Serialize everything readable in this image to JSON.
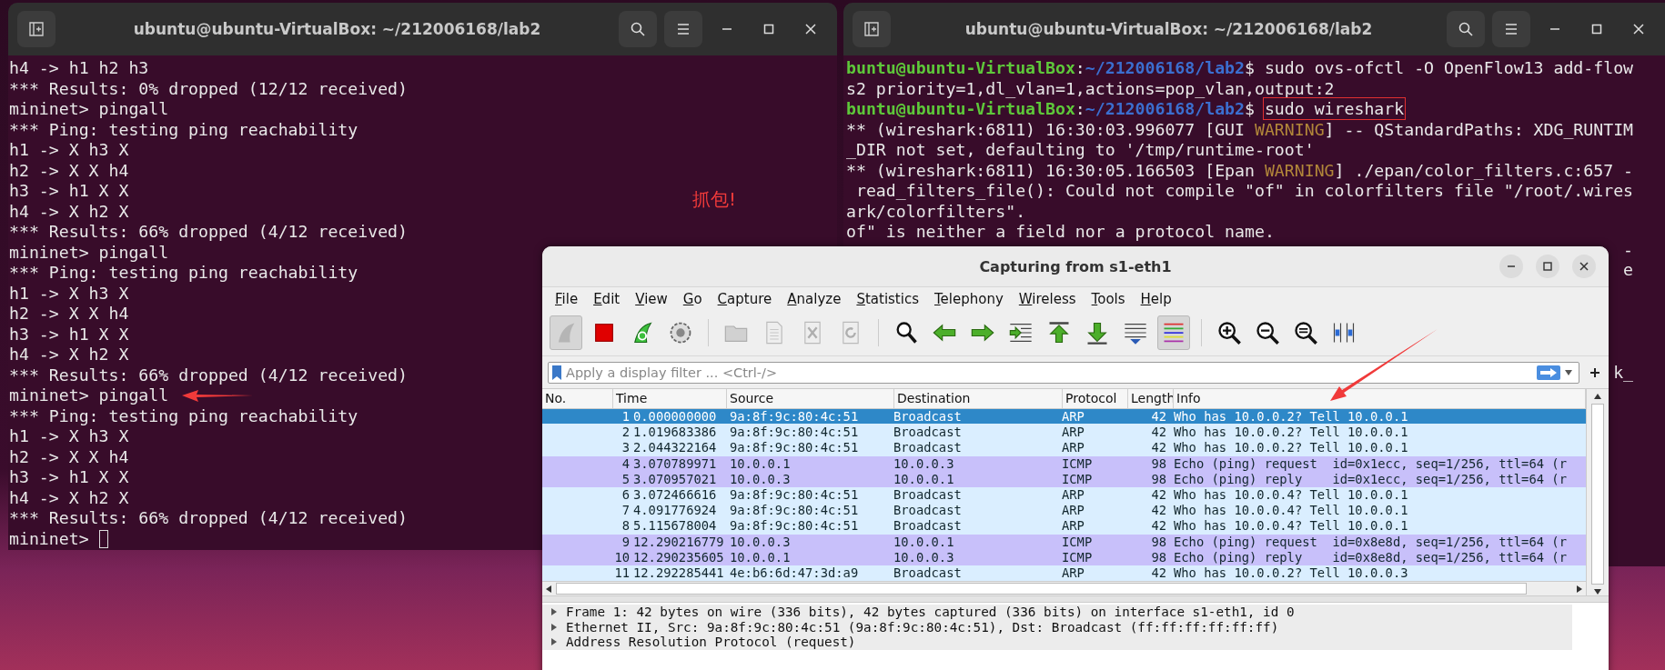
{
  "terminal_left": {
    "title": "ubuntu@ubuntu-VirtualBox: ~/212006168/lab2",
    "lines": [
      {
        "text": "h4 -> h1 h2 h3"
      },
      {
        "text": "*** Results: 0% dropped (12/12 received)"
      },
      {
        "text": "mininet> pingall"
      },
      {
        "text": "*** Ping: testing ping reachability"
      },
      {
        "text": "h1 -> X h3 X"
      },
      {
        "text": "h2 -> X X h4"
      },
      {
        "text": "h3 -> h1 X X"
      },
      {
        "text": "h4 -> X h2 X"
      },
      {
        "text": "*** Results: 66% dropped (4/12 received)"
      },
      {
        "text": "mininet> pingall"
      },
      {
        "text": "*** Ping: testing ping reachability"
      },
      {
        "text": "h1 -> X h3 X"
      },
      {
        "text": "h2 -> X X h4"
      },
      {
        "text": "h3 -> h1 X X"
      },
      {
        "text": "h4 -> X h2 X"
      },
      {
        "text": "*** Results: 66% dropped (4/12 received)"
      },
      {
        "text": "mininet> pingall"
      },
      {
        "text": "*** Ping: testing ping reachability"
      },
      {
        "text": "h1 -> X h3 X"
      },
      {
        "text": "h2 -> X X h4"
      },
      {
        "text": "h3 -> h1 X X"
      },
      {
        "text": "h4 -> X h2 X"
      },
      {
        "text": "*** Results: 66% dropped (4/12 received)"
      },
      {
        "text": "mininet>",
        "cursor": true
      }
    ]
  },
  "note": "抓包!",
  "terminal_right": {
    "title": "ubuntu@ubuntu-VirtualBox: ~/212006168/lab2",
    "lines": [
      [
        {
          "kind": "user",
          "text": "buntu@ubuntu-VirtualBox"
        },
        {
          "kind": "plain",
          "text": ":"
        },
        {
          "kind": "path",
          "text": "~/212006168/lab2"
        },
        {
          "kind": "plain",
          "text": "$ sudo ovs-ofctl -O OpenFlow13 add-flow"
        }
      ],
      [
        {
          "kind": "plain",
          "text": "s2 priority=1,dl_vlan=1,actions=pop_vlan,output:2"
        }
      ],
      [
        {
          "kind": "user",
          "text": "buntu@ubuntu-VirtualBox"
        },
        {
          "kind": "plain",
          "text": ":"
        },
        {
          "kind": "path",
          "text": "~/212006168/lab2"
        },
        {
          "kind": "plain",
          "text": "$ "
        },
        {
          "kind": "boxed",
          "text": "sudo wireshark"
        }
      ],
      [
        {
          "kind": "plain",
          "text": "** (wireshark:6811) 16:30:03.996077 [GUI "
        },
        {
          "kind": "warn",
          "text": "WARNING"
        },
        {
          "kind": "plain",
          "text": "] -- QStandardPaths: XDG_RUNTIM"
        }
      ],
      [
        {
          "kind": "plain",
          "text": "_DIR not set, defaulting to '/tmp/runtime-root'"
        }
      ],
      [
        {
          "kind": "plain",
          "text": "** (wireshark:6811) 16:30:05.166503 [Epan "
        },
        {
          "kind": "warn",
          "text": "WARNING"
        },
        {
          "kind": "plain",
          "text": "] ./epan/color_filters.c:657 -"
        }
      ],
      [
        {
          "kind": "plain",
          "text": " read_filters_file(): Could not compile \"of\" in colorfilters file \"/root/.wires"
        }
      ],
      [
        {
          "kind": "plain",
          "text": "ark/colorfilters\"."
        }
      ],
      [
        {
          "kind": "plain",
          "text": "of\" is neither a field nor a protocol name."
        }
      ]
    ],
    "edge_fragments": [
      "-",
      "e",
      "k_"
    ]
  },
  "wireshark": {
    "title": "Capturing from s1-eth1",
    "menu": [
      "File",
      "Edit",
      "View",
      "Go",
      "Capture",
      "Analyze",
      "Statistics",
      "Telephony",
      "Wireless",
      "Tools",
      "Help"
    ],
    "toolbar": [
      {
        "pressed": true,
        "disabled": true
      },
      {
        "pressed": false,
        "disabled": false
      },
      {
        "pressed": false,
        "disabled": false
      },
      {
        "pressed": false,
        "disabled": false
      },
      {
        "pressed": false,
        "disabled": true
      },
      {
        "pressed": false,
        "disabled": true
      },
      {
        "pressed": false,
        "disabled": true
      },
      {
        "pressed": false,
        "disabled": true
      },
      {
        "pressed": false,
        "disabled": false
      },
      {
        "pressed": false,
        "disabled": false
      },
      {
        "pressed": false,
        "disabled": false
      },
      {
        "pressed": false,
        "disabled": false
      },
      {
        "pressed": false,
        "disabled": false
      },
      {
        "pressed": false,
        "disabled": false
      },
      {
        "pressed": false,
        "disabled": false
      },
      {
        "pressed": true,
        "disabled": false
      },
      {
        "pressed": false,
        "disabled": false
      },
      {
        "pressed": false,
        "disabled": false
      },
      {
        "pressed": false,
        "disabled": false
      },
      {
        "pressed": false,
        "disabled": false
      }
    ],
    "filter": {
      "placeholder": "Apply a display filter ... <Ctrl-/>"
    },
    "columns": [
      "No.",
      "Time",
      "Source",
      "Destination",
      "Protocol",
      "Length",
      "Info"
    ],
    "rows": [
      {
        "no": "1",
        "time": "0.000000000",
        "source": "9a:8f:9c:80:4c:51",
        "destination": "Broadcast",
        "protocol": "ARP",
        "length": "42",
        "info": "Who has 10.0.0.2? Tell 10.0.0.1",
        "selected": true,
        "color": "#daeeff"
      },
      {
        "no": "2",
        "time": "1.019683386",
        "source": "9a:8f:9c:80:4c:51",
        "destination": "Broadcast",
        "protocol": "ARP",
        "length": "42",
        "info": "Who has 10.0.0.2? Tell 10.0.0.1",
        "selected": false,
        "color": "#daeeff"
      },
      {
        "no": "3",
        "time": "2.044322164",
        "source": "9a:8f:9c:80:4c:51",
        "destination": "Broadcast",
        "protocol": "ARP",
        "length": "42",
        "info": "Who has 10.0.0.2? Tell 10.0.0.1",
        "selected": false,
        "color": "#daeeff"
      },
      {
        "no": "4",
        "time": "3.070789971",
        "source": "10.0.0.1",
        "destination": "10.0.0.3",
        "protocol": "ICMP",
        "length": "98",
        "info": "Echo (ping) request  id=0x1ecc, seq=1/256, ttl=64 (r",
        "selected": false,
        "color": "#c8c0fa"
      },
      {
        "no": "5",
        "time": "3.070957021",
        "source": "10.0.0.3",
        "destination": "10.0.0.1",
        "protocol": "ICMP",
        "length": "98",
        "info": "Echo (ping) reply    id=0x1ecc, seq=1/256, ttl=64 (r",
        "selected": false,
        "color": "#c8c0fa"
      },
      {
        "no": "6",
        "time": "3.072466616",
        "source": "9a:8f:9c:80:4c:51",
        "destination": "Broadcast",
        "protocol": "ARP",
        "length": "42",
        "info": "Who has 10.0.0.4? Tell 10.0.0.1",
        "selected": false,
        "color": "#daeeff"
      },
      {
        "no": "7",
        "time": "4.091776924",
        "source": "9a:8f:9c:80:4c:51",
        "destination": "Broadcast",
        "protocol": "ARP",
        "length": "42",
        "info": "Who has 10.0.0.4? Tell 10.0.0.1",
        "selected": false,
        "color": "#daeeff"
      },
      {
        "no": "8",
        "time": "5.115678004",
        "source": "9a:8f:9c:80:4c:51",
        "destination": "Broadcast",
        "protocol": "ARP",
        "length": "42",
        "info": "Who has 10.0.0.4? Tell 10.0.0.1",
        "selected": false,
        "color": "#daeeff"
      },
      {
        "no": "9",
        "time": "12.290216779",
        "source": "10.0.0.3",
        "destination": "10.0.0.1",
        "protocol": "ICMP",
        "length": "98",
        "info": "Echo (ping) request  id=0x8e8d, seq=1/256, ttl=64 (r",
        "selected": false,
        "color": "#c8c0fa"
      },
      {
        "no": "10",
        "time": "12.290235605",
        "source": "10.0.0.1",
        "destination": "10.0.0.3",
        "protocol": "ICMP",
        "length": "98",
        "info": "Echo (ping) reply    id=0x8e8d, seq=1/256, ttl=64 (r",
        "selected": false,
        "color": "#c8c0fa"
      },
      {
        "no": "11",
        "time": "12.292285441",
        "source": "4e:b6:6d:47:3d:a9",
        "destination": "Broadcast",
        "protocol": "ARP",
        "length": "42",
        "info": "Who has 10.0.0.2? Tell 10.0.0.3",
        "selected": false,
        "color": "#daeeff"
      }
    ],
    "details": [
      {
        "text": "Frame 1: 42 bytes on wire (336 bits), 42 bytes captured (336 bits) on interface s1-eth1, id 0",
        "expanded": false
      },
      {
        "text": "Ethernet II, Src: 9a:8f:9c:80:4c:51 (9a:8f:9c:80:4c:51), Dst: Broadcast (ff:ff:ff:ff:ff:ff)",
        "expanded": false
      },
      {
        "text": "Address Resolution Protocol (request)",
        "expanded": false
      }
    ]
  }
}
